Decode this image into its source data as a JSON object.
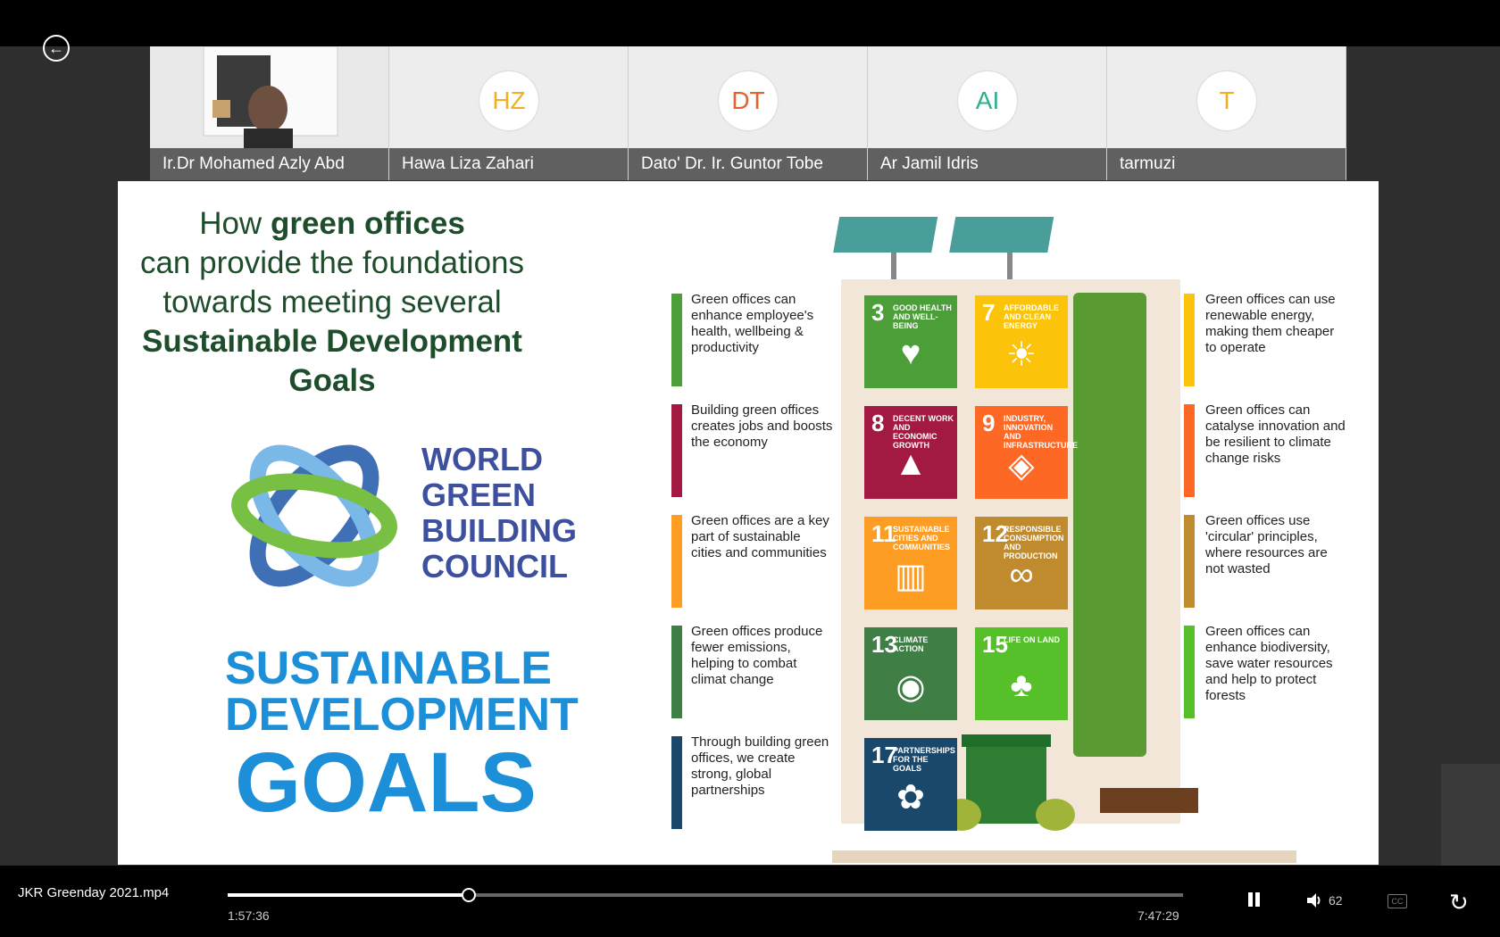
{
  "participants": [
    {
      "name": "Ir.Dr Mohamed Azly Abd",
      "initials": "",
      "color": "",
      "video": true
    },
    {
      "name": "Hawa Liza Zahari",
      "initials": "HZ",
      "color": "#f0b020"
    },
    {
      "name": "Dato' Dr. Ir. Guntor Tobe",
      "initials": "DT",
      "color": "#e8602c"
    },
    {
      "name": "Ar Jamil Idris",
      "initials": "AI",
      "color": "#2bb08e"
    },
    {
      "name": "tarmuzi",
      "initials": "T",
      "color": "#f0b020"
    }
  ],
  "slide": {
    "headline": {
      "line1_pre": "How ",
      "line1_bold": "green offices",
      "line2": "can provide the foundations",
      "line3": "towards meeting several",
      "line4": "Sustainable Development Goals"
    },
    "wgbc": [
      "WORLD",
      "GREEN",
      "BUILDING",
      "COUNCIL"
    ],
    "sdg": {
      "line1": "SUSTAINABLE",
      "line2": "DEVELOPMENT",
      "line3": "GOALS"
    },
    "left_points": [
      {
        "text": "Green offices can enhance employee's health, wellbeing & productivity",
        "color": "#4c9f38"
      },
      {
        "text": "Building green offices creates jobs and boosts the economy",
        "color": "#a21942"
      },
      {
        "text": "Green offices are a key part of sustainable cities and communities",
        "color": "#fd9d24"
      },
      {
        "text": "Green offices produce fewer emissions, helping to combat climat change",
        "color": "#3f7e44"
      },
      {
        "text": "Through building green offices, we create strong, global partnerships",
        "color": "#19486a"
      }
    ],
    "right_points": [
      {
        "text": "Green offices can use renewable energy, making them cheaper to operate",
        "color": "#fcc30b"
      },
      {
        "text": "Green offices can catalyse innovation and be resilient to climate change risks",
        "color": "#fd6925"
      },
      {
        "text": "Green offices use 'circular' principles, where resources are not wasted",
        "color": "#bf8b2e"
      },
      {
        "text": "Green offices can enhance biodiversity, save water resources and help to protect forests",
        "color": "#56c02b"
      }
    ],
    "goals": [
      {
        "num": "3",
        "label": "GOOD HEALTH AND WELL-BEING",
        "color": "#4c9f38",
        "icon": "heartbeat-icon",
        "glyph": "♥"
      },
      {
        "num": "7",
        "label": "AFFORDABLE AND CLEAN ENERGY",
        "color": "#fcc30b",
        "icon": "sun-icon",
        "glyph": "☀"
      },
      {
        "num": "8",
        "label": "DECENT WORK AND ECONOMIC GROWTH",
        "color": "#a21942",
        "icon": "growth-chart-icon",
        "glyph": "▲"
      },
      {
        "num": "9",
        "label": "INDUSTRY, INNOVATION AND INFRASTRUCTURE",
        "color": "#fd6925",
        "icon": "cubes-icon",
        "glyph": "◈"
      },
      {
        "num": "11",
        "label": "SUSTAINABLE CITIES AND COMMUNITIES",
        "color": "#fd9d24",
        "icon": "city-icon",
        "glyph": "▥"
      },
      {
        "num": "12",
        "label": "RESPONSIBLE CONSUMPTION AND PRODUCTION",
        "color": "#bf8b2e",
        "icon": "infinity-icon",
        "glyph": "∞"
      },
      {
        "num": "13",
        "label": "CLIMATE ACTION",
        "color": "#3f7e44",
        "icon": "eye-globe-icon",
        "glyph": "◉"
      },
      {
        "num": "15",
        "label": "LIFE ON LAND",
        "color": "#56c02b",
        "icon": "tree-icon",
        "glyph": "♣"
      },
      {
        "num": "17",
        "label": "PARTNERSHIPS FOR THE GOALS",
        "color": "#19486a",
        "icon": "flower-icon",
        "glyph": "✿"
      }
    ]
  },
  "player": {
    "filename": "JKR Greenday 2021.mp4",
    "current_time": "1:57:36",
    "total_time": "7:47:29",
    "progress": 0.2515,
    "volume": "62",
    "cc_label": "CC"
  }
}
